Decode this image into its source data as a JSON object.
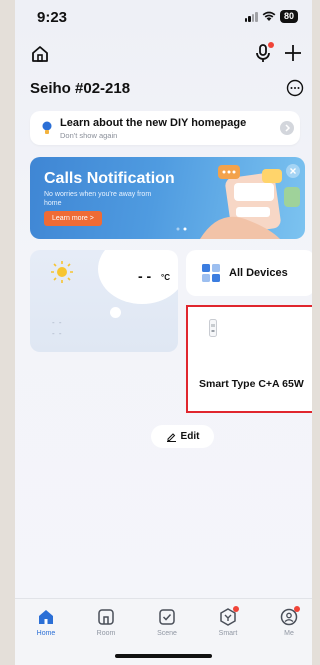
{
  "status_bar": {
    "time": "9:23",
    "battery": "80"
  },
  "header": {
    "home_name": "Seiho #02-218"
  },
  "diy_banner": {
    "title": "Learn about the new DIY homepage",
    "subtitle": "Don't show again"
  },
  "promo": {
    "title": "Calls Notification",
    "subtitle": "No worries when you're away from home",
    "button": "Learn more >"
  },
  "weather": {
    "temperature": "- -",
    "unit": "°C",
    "line1": "- -",
    "line2": "- -"
  },
  "all_devices": {
    "label": "All Devices"
  },
  "device": {
    "name": "Smart Type C+A 65W"
  },
  "edit": {
    "label": "Edit"
  },
  "tabs": [
    {
      "label": "Home",
      "icon": "home-icon",
      "active": true
    },
    {
      "label": "Room",
      "icon": "room-icon",
      "active": false
    },
    {
      "label": "Scene",
      "icon": "scene-icon",
      "active": false
    },
    {
      "label": "Smart",
      "icon": "smart-icon",
      "active": false
    },
    {
      "label": "Me",
      "icon": "me-icon",
      "active": false
    }
  ],
  "colors": {
    "accent": "#2b6fd6",
    "highlight": "#e0262e",
    "badge": "#f04438",
    "promo_button": "#ef6b35"
  }
}
